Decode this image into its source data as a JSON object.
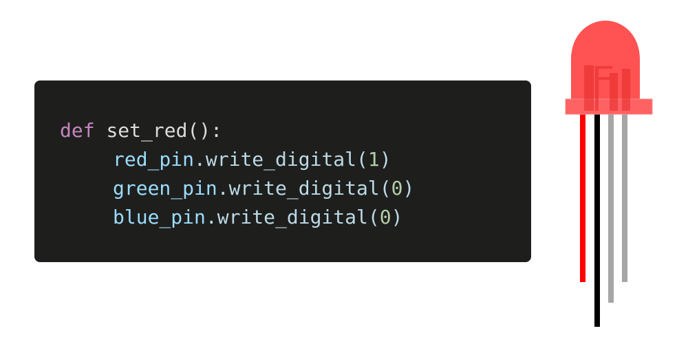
{
  "code": {
    "lines": [
      {
        "keyword": "def",
        "name": "set_red():"
      },
      {
        "target": "red_pin",
        "method": ".write_digital(",
        "value": "1",
        "close": ")"
      },
      {
        "target": "green_pin",
        "method": ".write_digital(",
        "value": "0",
        "close": ")"
      },
      {
        "target": "blue_pin",
        "method": ".write_digital(",
        "value": "0",
        "close": ")"
      }
    ]
  },
  "led": {
    "icon": "rgb-led-icon",
    "body_color": "#ff4b4b",
    "rim_color": "#f06a6a",
    "leg_colors": [
      "#ff0000",
      "#000000",
      "#a6a6a6",
      "#a6a6a6"
    ]
  }
}
